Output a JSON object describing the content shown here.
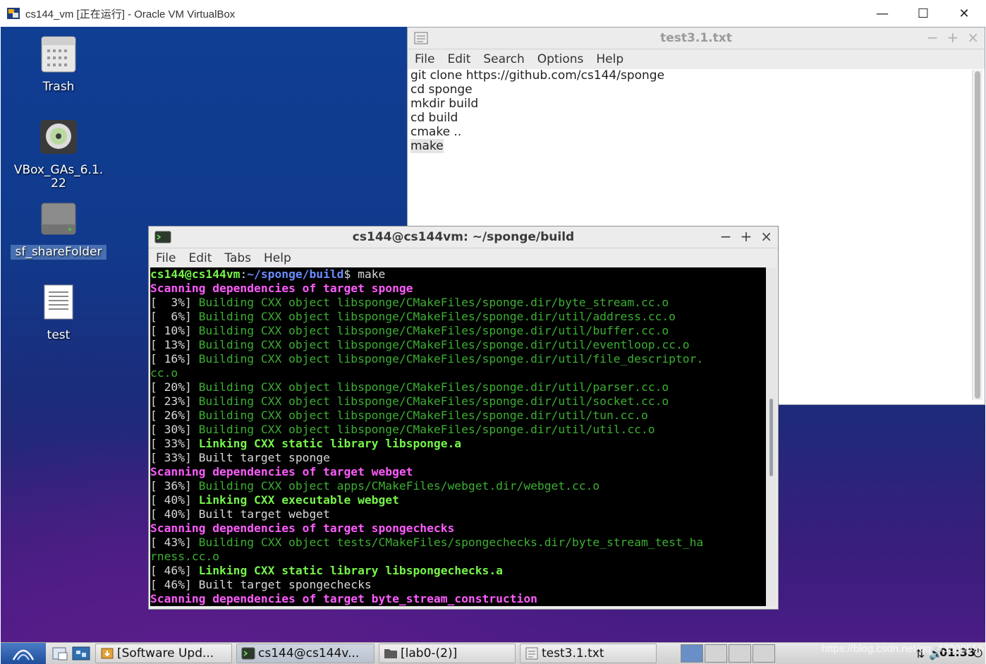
{
  "host_window": {
    "title": "cs144_vm [正在运行] - Oracle VM VirtualBox",
    "minimize": "—",
    "maximize": "☐",
    "close": "✕"
  },
  "desktop_icons": [
    {
      "label": "Trash",
      "icon": "trash-icon"
    },
    {
      "label": "VBox_GAs_6.1.22",
      "icon": "optical-disc-icon"
    },
    {
      "label": "sf_shareFolder",
      "icon": "drive-icon"
    },
    {
      "label": "test",
      "icon": "text-file-icon"
    }
  ],
  "editor": {
    "title": "test3.1.txt",
    "menu": [
      "File",
      "Edit",
      "Search",
      "Options",
      "Help"
    ],
    "lines": [
      "git clone https://github.com/cs144/sponge",
      "cd sponge",
      "mkdir build",
      "cd build",
      "cmake ..",
      "make"
    ]
  },
  "terminal": {
    "title": "cs144@cs144vm: ~/sponge/build",
    "menu": [
      "File",
      "Edit",
      "Tabs",
      "Help"
    ],
    "prompt_user": "cs144@cs144vm",
    "prompt_sep": ":",
    "prompt_path": "~/sponge/build",
    "prompt_cmd": "$ make",
    "lines": [
      {
        "pct": "",
        "text": "Scanning dependencies of target sponge",
        "style": "mag"
      },
      {
        "pct": "[  3%] ",
        "text": "Building CXX object libsponge/CMakeFiles/sponge.dir/byte_stream.cc.o",
        "style": "build"
      },
      {
        "pct": "[  6%] ",
        "text": "Building CXX object libsponge/CMakeFiles/sponge.dir/util/address.cc.o",
        "style": "build"
      },
      {
        "pct": "[ 10%] ",
        "text": "Building CXX object libsponge/CMakeFiles/sponge.dir/util/buffer.cc.o",
        "style": "build"
      },
      {
        "pct": "[ 13%] ",
        "text": "Building CXX object libsponge/CMakeFiles/sponge.dir/util/eventloop.cc.o",
        "style": "build"
      },
      {
        "pct": "[ 16%] ",
        "text": "Building CXX object libsponge/CMakeFiles/sponge.dir/util/file_descriptor.",
        "style": "build"
      },
      {
        "pct": "",
        "text": "cc.o",
        "style": "build"
      },
      {
        "pct": "[ 20%] ",
        "text": "Building CXX object libsponge/CMakeFiles/sponge.dir/util/parser.cc.o",
        "style": "build"
      },
      {
        "pct": "[ 23%] ",
        "text": "Building CXX object libsponge/CMakeFiles/sponge.dir/util/socket.cc.o",
        "style": "build"
      },
      {
        "pct": "[ 26%] ",
        "text": "Building CXX object libsponge/CMakeFiles/sponge.dir/util/tun.cc.o",
        "style": "build"
      },
      {
        "pct": "[ 30%] ",
        "text": "Building CXX object libsponge/CMakeFiles/sponge.dir/util/util.cc.o",
        "style": "build"
      },
      {
        "pct": "[ 33%] ",
        "text": "Linking CXX static library libsponge.a",
        "style": "link"
      },
      {
        "pct": "[ 33%] ",
        "text": "Built target sponge",
        "style": "plain"
      },
      {
        "pct": "",
        "text": "Scanning dependencies of target webget",
        "style": "mag"
      },
      {
        "pct": "[ 36%] ",
        "text": "Building CXX object apps/CMakeFiles/webget.dir/webget.cc.o",
        "style": "build"
      },
      {
        "pct": "[ 40%] ",
        "text": "Linking CXX executable webget",
        "style": "link"
      },
      {
        "pct": "[ 40%] ",
        "text": "Built target webget",
        "style": "plain"
      },
      {
        "pct": "",
        "text": "Scanning dependencies of target spongechecks",
        "style": "mag"
      },
      {
        "pct": "[ 43%] ",
        "text": "Building CXX object tests/CMakeFiles/spongechecks.dir/byte_stream_test_ha",
        "style": "build"
      },
      {
        "pct": "",
        "text": "rness.cc.o",
        "style": "build"
      },
      {
        "pct": "[ 46%] ",
        "text": "Linking CXX static library libspongechecks.a",
        "style": "link"
      },
      {
        "pct": "[ 46%] ",
        "text": "Built target spongechecks",
        "style": "plain"
      },
      {
        "pct": "",
        "text": "Scanning dependencies of target byte_stream_construction",
        "style": "mag"
      }
    ]
  },
  "taskbar": {
    "tasks": [
      {
        "label": "[Software Upd...",
        "icon": "software-update-icon"
      },
      {
        "label": "cs144@cs144v...",
        "icon": "terminal-icon"
      },
      {
        "label": "[lab0-(2)]",
        "icon": "folder-icon"
      },
      {
        "label": "test3.1.txt",
        "icon": "text-editor-icon"
      }
    ],
    "clock": "01:33",
    "watermark": "https://blog.csdn.net/qq_43800555"
  }
}
